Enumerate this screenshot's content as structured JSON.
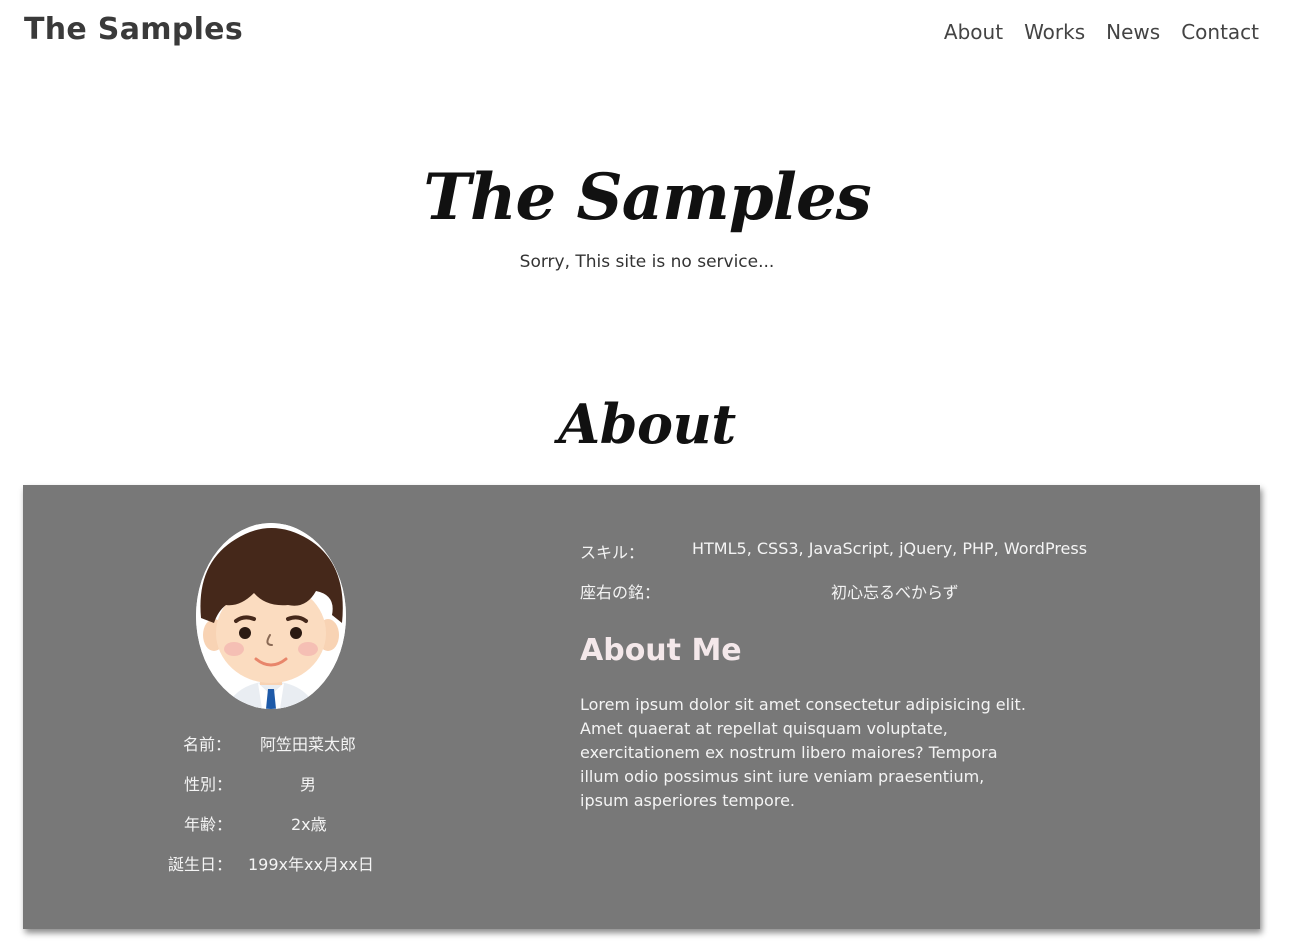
{
  "header": {
    "logo": "The Samples",
    "nav": [
      {
        "label": "About"
      },
      {
        "label": "Works"
      },
      {
        "label": "News"
      },
      {
        "label": "Contact"
      }
    ]
  },
  "hero": {
    "title": "The Samples",
    "subtitle": "Sorry, This site is no service..."
  },
  "about": {
    "section_title": "About",
    "profile": [
      {
        "label": "名前：",
        "value": "阿笠田菜太郎"
      },
      {
        "label": "性別：",
        "value": "男"
      },
      {
        "label": "年齢：",
        "value": "2x歳"
      },
      {
        "label": "誕生日：",
        "value": "199x年xx月xx日"
      }
    ],
    "skills_label": "スキル：",
    "skills_value": "HTML5, CSS3, JavaScript, jQuery, PHP, WordPress",
    "motto_label": "座右の銘：",
    "motto_value": "初心忘るべからず",
    "about_me_title": "About Me",
    "about_me_body": "Lorem ipsum dolor sit amet consectetur adipisicing elit. Amet quaerat at repellat quisquam voluptate, exercitationem ex nostrum libero maiores? Tempora illum odio possimus sint iure veniam praesentium, ipsum asperiores tempore."
  },
  "colors": {
    "card_background": "#787878",
    "card_text": "#f4f4f4",
    "about_me_title": "#f4e8ea",
    "header_text": "#3a3a3a"
  },
  "icons": {
    "avatar": "boy-avatar-illustration"
  }
}
